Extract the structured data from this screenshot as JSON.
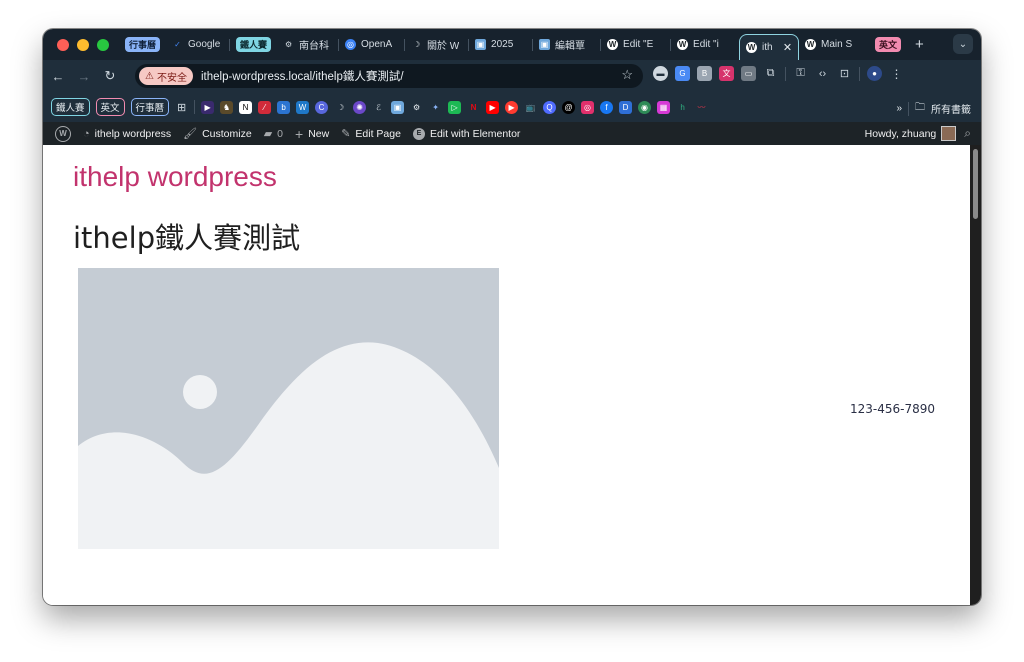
{
  "tabs": [
    {
      "group": "行事曆",
      "group_color": "#8ab4f8",
      "group_text": "#10213a"
    },
    {
      "label": "Google",
      "fav_color": "#4285f4",
      "fav": "✓"
    },
    {
      "group": "鐵人賽",
      "group_color": "#7fd5e3",
      "group_text": "#0d2a30"
    },
    {
      "label": "南台科",
      "fav_color": "#555555",
      "fav": "⚙"
    },
    {
      "label": "OpenA",
      "fav_color": "#3b82f6",
      "fav": "◎"
    },
    {
      "label": "關於 W",
      "fav_color": "#222222",
      "fav": "☽"
    },
    {
      "label": "2025 ",
      "fav_color": "#6fa8dc",
      "fav": "▣"
    },
    {
      "label": "編輯覃",
      "fav_color": "#6fa8dc",
      "fav": "▣"
    },
    {
      "label": "Edit \"E",
      "fav_color": "#ffffff",
      "fav": "W"
    },
    {
      "label": "Edit \"i",
      "fav_color": "#ffffff",
      "fav": "W"
    },
    {
      "label": "ith",
      "fav_color": "#ffffff",
      "fav": "W",
      "active": true
    },
    {
      "label": "Main S",
      "fav_color": "#ffffff",
      "fav": "W"
    },
    {
      "group": "英文",
      "group_color": "#f28bb0",
      "group_text": "#3a0f1e"
    }
  ],
  "toolbar": {
    "back": "←",
    "forward": "→",
    "reload": "↻",
    "security_chip": "不安全",
    "url": "ithelp-wordpress.local/ithelp鐵人賽測試/",
    "star": "☆"
  },
  "bookmarks": {
    "groups": [
      {
        "label": "鐵人賽",
        "color": "#7fd5e3"
      },
      {
        "label": "英文",
        "color": "#f28bb0"
      },
      {
        "label": "行事曆",
        "color": "#8ab4f8"
      }
    ],
    "overflow": "»",
    "folder_label": "所有書籤"
  },
  "adminbar": {
    "site_name": "ithelp wordpress",
    "customize": "Customize",
    "comments_count": "0",
    "new_label": "New",
    "edit_page": "Edit Page",
    "elementor": "Edit with Elementor",
    "greeting": "Howdy, zhuang"
  },
  "page": {
    "site_title": "ithelp wordpress",
    "title": "ithelp鐵人賽測試",
    "phone": "123-456-7890"
  }
}
